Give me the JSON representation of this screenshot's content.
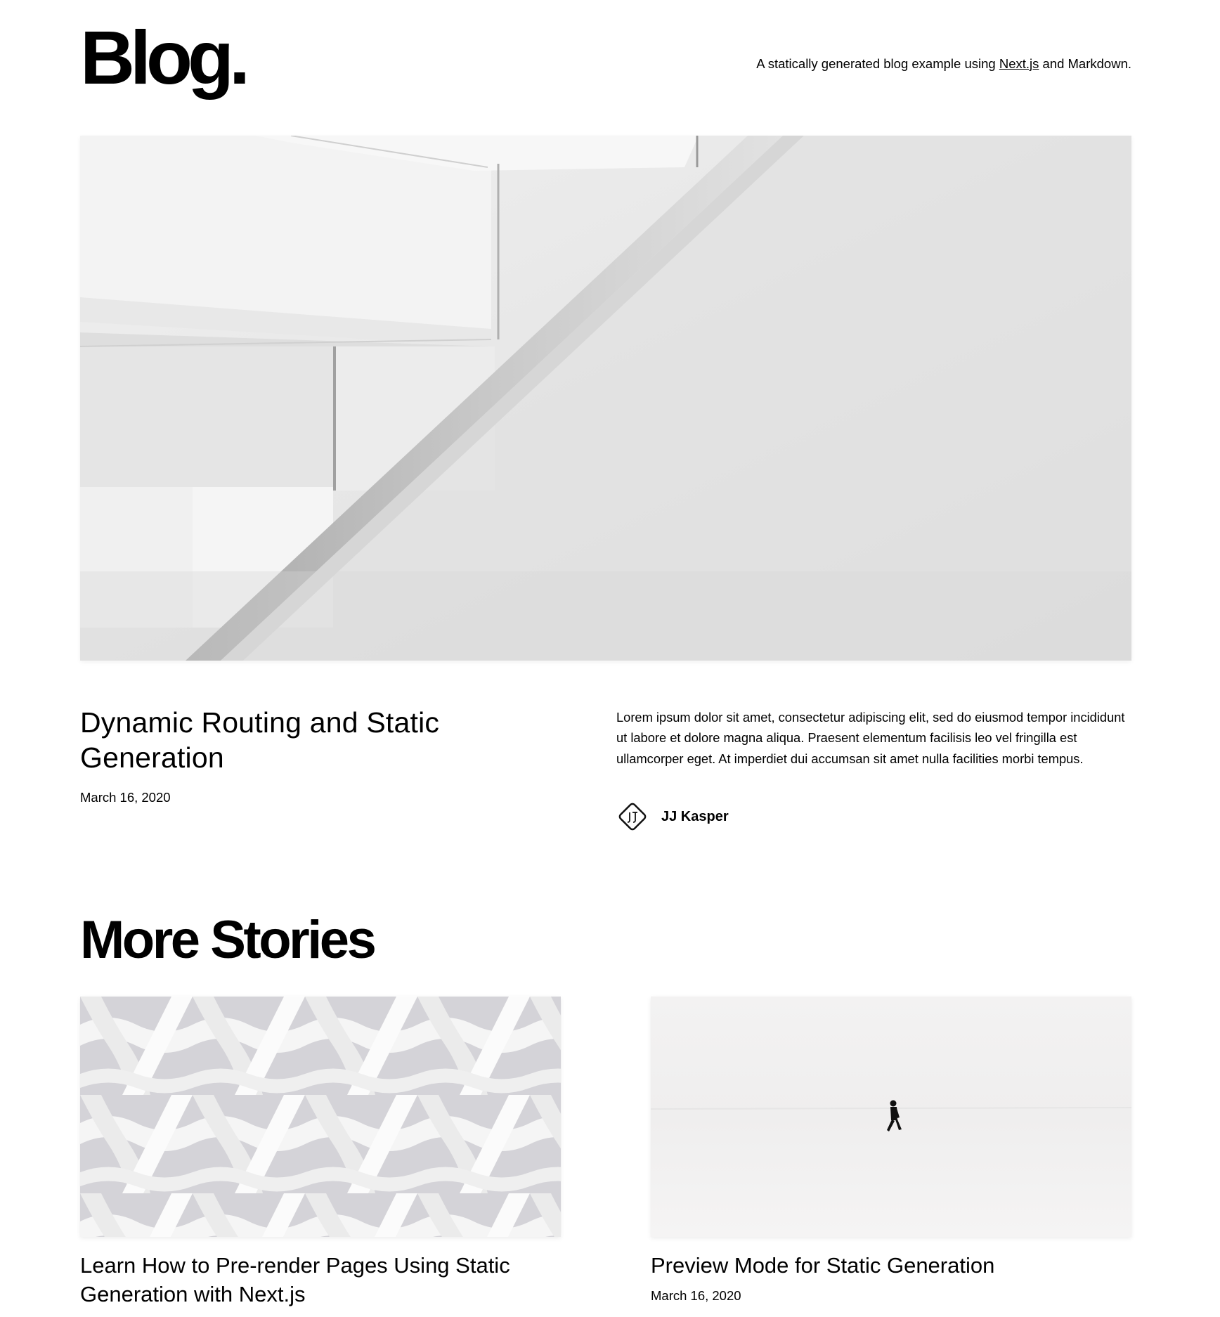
{
  "header": {
    "site_title": "Blog.",
    "tagline_prefix": "A statically generated blog example using ",
    "tagline_link": "Next.js",
    "tagline_suffix": " and Markdown."
  },
  "hero": {
    "image_alt": "white staircase",
    "title": "Dynamic Routing and Static Generation",
    "date": "March 16, 2020",
    "excerpt": "Lorem ipsum dolor sit amet, consectetur adipiscing elit, sed do eiusmod tempor incididunt ut labore et dolore magna aliqua. Praesent elementum facilisis leo vel fringilla est ullamcorper eget. At imperdiet dui accumsan sit amet nulla facilities morbi tempus.",
    "author": {
      "name": "JJ Kasper",
      "avatar_icon": "jj-logo-icon"
    }
  },
  "more_stories": {
    "title": "More Stories",
    "posts": [
      {
        "image_alt": "white woven pattern",
        "title": "Learn How to Pre-render Pages Using Static Generation with Next.js",
        "date": ""
      },
      {
        "image_alt": "person walking in snow",
        "title": "Preview Mode for Static Generation",
        "date": "March 16, 2020"
      }
    ]
  }
}
